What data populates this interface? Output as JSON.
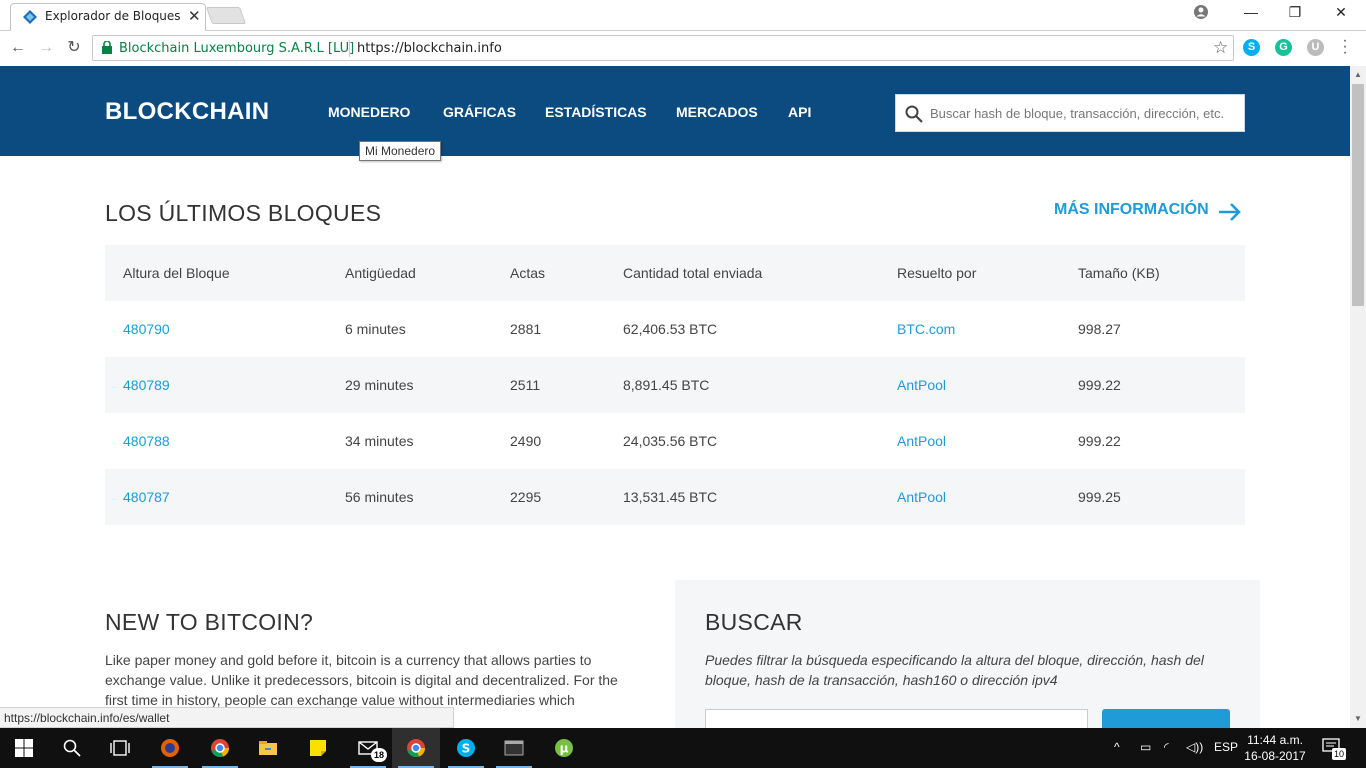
{
  "browser": {
    "tab_title": "Explorador de Bloques de Bitcoin",
    "security_label": "Blockchain Luxembourg S.A.R.L [LU]",
    "url": "https://blockchain.info",
    "status_url": "https://blockchain.info/es/wallet"
  },
  "site": {
    "logo": "BLOCKCHAIN",
    "nav": [
      "MONEDERO",
      "GRÁFICAS",
      "ESTADÍSTICAS",
      "MERCADOS",
      "API"
    ],
    "search_placeholder": "Buscar hash de bloque, transacción, dirección, etc.",
    "tooltip": "Mi Monedero"
  },
  "latest_blocks": {
    "title": "LOS ÚLTIMOS BLOQUES",
    "more_link": "MÁS INFORMACIÓN",
    "columns": [
      "Altura del Bloque",
      "Antigüedad",
      "Actas",
      "Cantidad total enviada",
      "Resuelto por",
      "Tamaño (KB)"
    ],
    "rows": [
      [
        "480790",
        "6 minutes",
        "2881",
        "62,406.53 BTC",
        "BTC.com",
        "998.27"
      ],
      [
        "480789",
        "29 minutes",
        "2511",
        "8,891.45 BTC",
        "AntPool",
        "999.22"
      ],
      [
        "480788",
        "34 minutes",
        "2490",
        "24,035.56 BTC",
        "AntPool",
        "999.22"
      ],
      [
        "480787",
        "56 minutes",
        "2295",
        "13,531.45 BTC",
        "AntPool",
        "999.25"
      ]
    ]
  },
  "new_to_bitcoin": {
    "title": "NEW TO BITCOIN?",
    "text": "Like paper money and gold before it, bitcoin is a currency that allows parties to exchange value. Unlike it predecessors, bitcoin is digital and decentralized. For the first time in history, people can exchange value without intermediaries which"
  },
  "search_panel": {
    "title": "BUSCAR",
    "description": "Puedes filtrar la búsqueda especificando la altura del bloque, dirección, hash del bloque, hash de la transacción, hash160 o dirección ipv4"
  },
  "taskbar": {
    "mail_badge": "18",
    "language": "ESP",
    "time": "11:44 a.m.",
    "date": "16-08-2017",
    "notifications": "10"
  },
  "colors": {
    "header_bg": "#0b4b80",
    "link": "#1f9bd7",
    "secure": "#0b8043"
  }
}
